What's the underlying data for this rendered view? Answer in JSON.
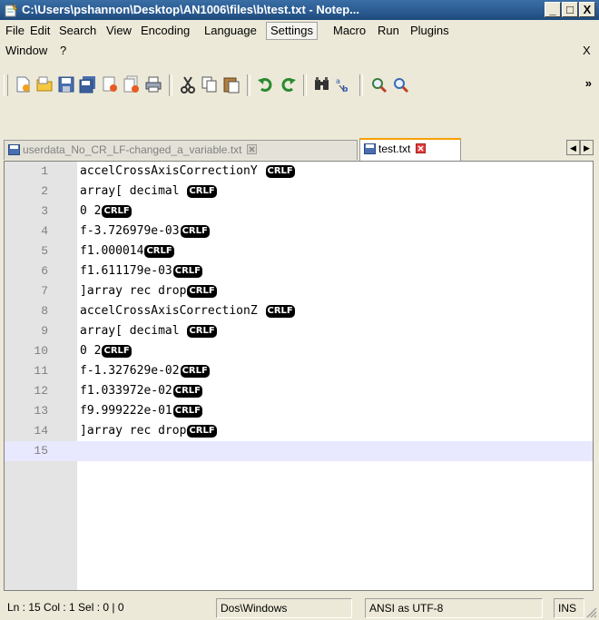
{
  "window": {
    "title": "C:\\Users\\pshannon\\Desktop\\AN1006\\files\\b\\test.txt - Notep...",
    "minimize": "_",
    "maximize": "□",
    "close": "X"
  },
  "menu": {
    "items": [
      "File",
      "Edit",
      "Search",
      "View",
      "Encoding",
      "Language",
      "Settings",
      "Macro",
      "Run",
      "Plugins"
    ],
    "row2": [
      "Window",
      "?"
    ],
    "close_doc": "X",
    "selected": "Settings"
  },
  "toolbar": {
    "icons": [
      "new-icon",
      "open-icon",
      "save-icon",
      "save-all-icon",
      "close-icon",
      "close-all-icon",
      "print-icon",
      "cut-icon",
      "copy-icon",
      "paste-icon",
      "undo-icon",
      "redo-icon",
      "find-icon",
      "replace-icon",
      "zoom-in-icon",
      "zoom-out-icon"
    ],
    "more": "»"
  },
  "tabs": [
    {
      "label": "userdata_No_CR_LF-changed_a_variable.txt",
      "active": false
    },
    {
      "label": "test.txt",
      "active": true
    }
  ],
  "scroll": {
    "left": "◀",
    "right": "▶"
  },
  "editor": {
    "eol_marker": "CRLF",
    "lines": [
      {
        "num": "1",
        "text": "accelCrossAxisCorrectionY "
      },
      {
        "num": "2",
        "text": "array[ decimal "
      },
      {
        "num": "3",
        "text": "0 2"
      },
      {
        "num": "4",
        "text": "f-3.726979e-03"
      },
      {
        "num": "5",
        "text": "f1.000014"
      },
      {
        "num": "6",
        "text": "f1.611179e-03"
      },
      {
        "num": "7",
        "text": "]array rec drop"
      },
      {
        "num": "8",
        "text": "accelCrossAxisCorrectionZ "
      },
      {
        "num": "9",
        "text": "array[ decimal "
      },
      {
        "num": "10",
        "text": "0 2"
      },
      {
        "num": "11",
        "text": "f-1.327629e-02"
      },
      {
        "num": "12",
        "text": "f1.033972e-02"
      },
      {
        "num": "13",
        "text": "f9.999222e-01"
      },
      {
        "num": "14",
        "text": "]array rec drop"
      },
      {
        "num": "15",
        "text": ""
      }
    ]
  },
  "status": {
    "position": "Ln : 15   Col : 1   Sel : 0 | 0",
    "eol": "Dos\\Windows",
    "encoding": "ANSI as UTF-8",
    "mode": "INS"
  },
  "colors": {
    "current_line": "#e8e8ff",
    "active_tab_accent": "#f8a000"
  }
}
